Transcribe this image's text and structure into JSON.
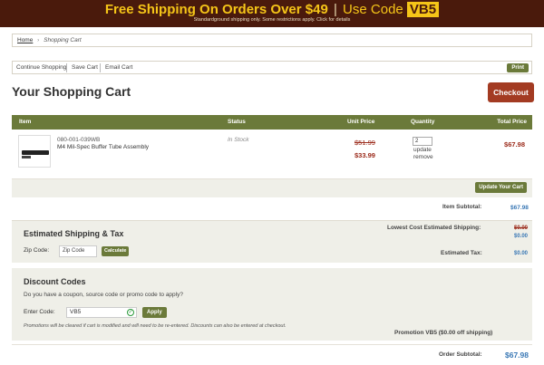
{
  "banner": {
    "headline": "Free Shipping On Orders Over $49",
    "use_code_text": "Use Code",
    "code": "VB5",
    "subtext": "Standardground shipping only. Some restrictions apply. Click for details"
  },
  "breadcrumb": {
    "home": "Home",
    "current": "Shopping Cart"
  },
  "actions": {
    "continue": "Continue Shopping",
    "save": "Save Cart",
    "email": "Email Cart",
    "print": "Print"
  },
  "page": {
    "title": "Your Shopping Cart",
    "checkout": "Checkout"
  },
  "table": {
    "headers": [
      "Item",
      "Status",
      "Unit Price",
      "Quantity",
      "Total Price"
    ],
    "item": {
      "sku": "080-001-039WB",
      "name": "M4 Mil-Spec Buffer Tube Assembly",
      "status": "In Stock",
      "old_price": "$51.99",
      "new_price": "$33.99",
      "quantity": "2",
      "update": "update",
      "remove": "remove",
      "total": "$67.98"
    },
    "update_button": "Update Your Cart"
  },
  "summary": {
    "item_subtotal_label": "Item Subtotal:",
    "item_subtotal": "$67.98",
    "lowest_shipping_label": "Lowest Cost Estimated Shipping:",
    "lowest_shipping_old": "$0.00",
    "lowest_shipping": "$0.00",
    "estimated_tax_label": "Estimated Tax:",
    "estimated_tax": "$0.00",
    "order_subtotal_label": "Order Subtotal:",
    "order_subtotal": "$67.98"
  },
  "shipping": {
    "title": "Estimated Shipping & Tax",
    "zip_label": "Zip Code:",
    "zip_placeholder": "Zip Code",
    "calculate": "Calculate"
  },
  "discount": {
    "title": "Discount Codes",
    "question": "Do you have a coupon, source code or promo code to apply?",
    "enter_label": "Enter Code:",
    "code_value": "VB5",
    "apply": "Apply",
    "note": "Promotions will be cleared if cart is modified and will need to be re-entered. Discounts can also be entered at checkout.",
    "promo_line": "Promotion VB5 ($0.00 off shipping)"
  },
  "colors": {
    "banner_bg": "#4a1a0c",
    "banner_text": "#f5c518",
    "header_green": "#6b7a3a",
    "checkout_red": "#a33b22",
    "price_red": "#9b2a1a",
    "value_blue": "#3a78b5"
  }
}
